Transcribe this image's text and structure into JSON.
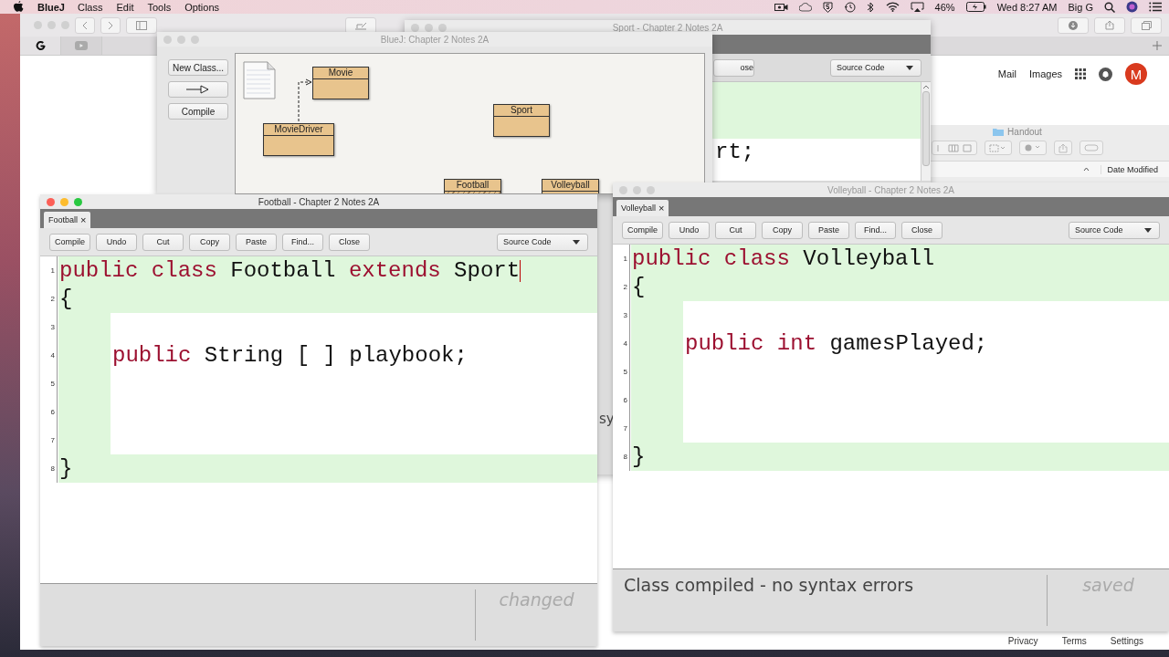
{
  "menu_bar": {
    "app": "BlueJ",
    "menus": [
      "Class",
      "Edit",
      "Tools",
      "Options"
    ],
    "battery": "46%",
    "clock": "Wed 8:27 AM",
    "user": "Big G"
  },
  "browser": {
    "top_links": [
      "Mail",
      "Images"
    ],
    "avatar": "M",
    "footer_links": [
      "Privacy",
      "Terms",
      "Settings"
    ]
  },
  "finder": {
    "title": "Handout",
    "column": "Date Modified"
  },
  "sport_window": {
    "title": "Sport - Chapter 2 Notes 2A",
    "button": "ose",
    "view_select": "Source Code",
    "code": [
      "rt;"
    ],
    "status": "sy"
  },
  "bluej": {
    "title": "BlueJ: Chapter 2 Notes 2A",
    "buttons": [
      {
        "kind": "text",
        "label": "New Class..."
      },
      {
        "kind": "arrow"
      },
      {
        "kind": "text",
        "label": "Compile"
      }
    ],
    "classes": [
      {
        "name": "Movie",
        "uncompiled": false
      },
      {
        "name": "MovieDriver",
        "uncompiled": false
      },
      {
        "name": "Sport",
        "uncompiled": false
      },
      {
        "name": "Football",
        "uncompiled": true
      },
      {
        "name": "Volleyball",
        "uncompiled": false
      }
    ]
  },
  "editors": [
    {
      "title": "Football - Chapter 2 Notes 2A",
      "active": true,
      "tab": {
        "label": "Football",
        "close": "×",
        "selected": true
      },
      "buttons": [
        "Compile",
        "Undo",
        "Cut",
        "Copy",
        "Paste",
        "Find...",
        "Close"
      ],
      "view_select": "Source Code",
      "lines": [
        {
          "number": "1",
          "inner": false,
          "tokens": [
            {
              "text": "public ",
              "kind": "keyword"
            },
            {
              "text": "class ",
              "kind": "keyword"
            },
            {
              "text": "Football ",
              "kind": "plain"
            },
            {
              "text": "extends ",
              "kind": "keyword"
            },
            {
              "text": "Sport",
              "kind": "plain"
            }
          ]
        },
        {
          "number": "2",
          "inner": false,
          "tokens": [
            {
              "text": "{",
              "kind": "plain"
            }
          ]
        },
        {
          "number": "3",
          "inner": true
        },
        {
          "number": "4",
          "inner": true,
          "tokens": [
            {
              "text": "public ",
              "kind": "keyword"
            },
            {
              "text": "String [ ] playbook;",
              "kind": "plain"
            }
          ]
        },
        {
          "number": "5",
          "inner": true
        },
        {
          "number": "6",
          "inner": true
        },
        {
          "number": "7",
          "inner": true
        },
        {
          "number": "8",
          "inner": false,
          "tokens": [
            {
              "text": "}",
              "kind": "plain"
            }
          ]
        }
      ],
      "state": "changed"
    },
    {
      "title": "Volleyball - Chapter 2 Notes 2A",
      "active": false,
      "tab": {
        "label": "Volleyball",
        "close": "×",
        "selected": true
      },
      "buttons": [
        "Compile",
        "Undo",
        "Cut",
        "Copy",
        "Paste",
        "Find...",
        "Close"
      ],
      "view_select": "Source Code",
      "lines": [
        {
          "number": "1",
          "inner": false,
          "tokens": [
            {
              "text": "public ",
              "kind": "keyword"
            },
            {
              "text": "class ",
              "kind": "keyword"
            },
            {
              "text": "Volleyball",
              "kind": "plain"
            }
          ]
        },
        {
          "number": "2",
          "inner": false,
          "tokens": [
            {
              "text": "{",
              "kind": "plain"
            }
          ]
        },
        {
          "number": "3",
          "inner": true
        },
        {
          "number": "4",
          "inner": true,
          "tokens": [
            {
              "text": "public ",
              "kind": "keyword"
            },
            {
              "text": "int ",
              "kind": "keyword"
            },
            {
              "text": "gamesPlayed;",
              "kind": "plain"
            }
          ]
        },
        {
          "number": "5",
          "inner": true
        },
        {
          "number": "6",
          "inner": true
        },
        {
          "number": "7",
          "inner": true
        },
        {
          "number": "8",
          "inner": false,
          "tokens": [
            {
              "text": "}",
              "kind": "plain"
            }
          ]
        }
      ],
      "message": "Class compiled - no syntax errors",
      "state": "saved"
    }
  ]
}
